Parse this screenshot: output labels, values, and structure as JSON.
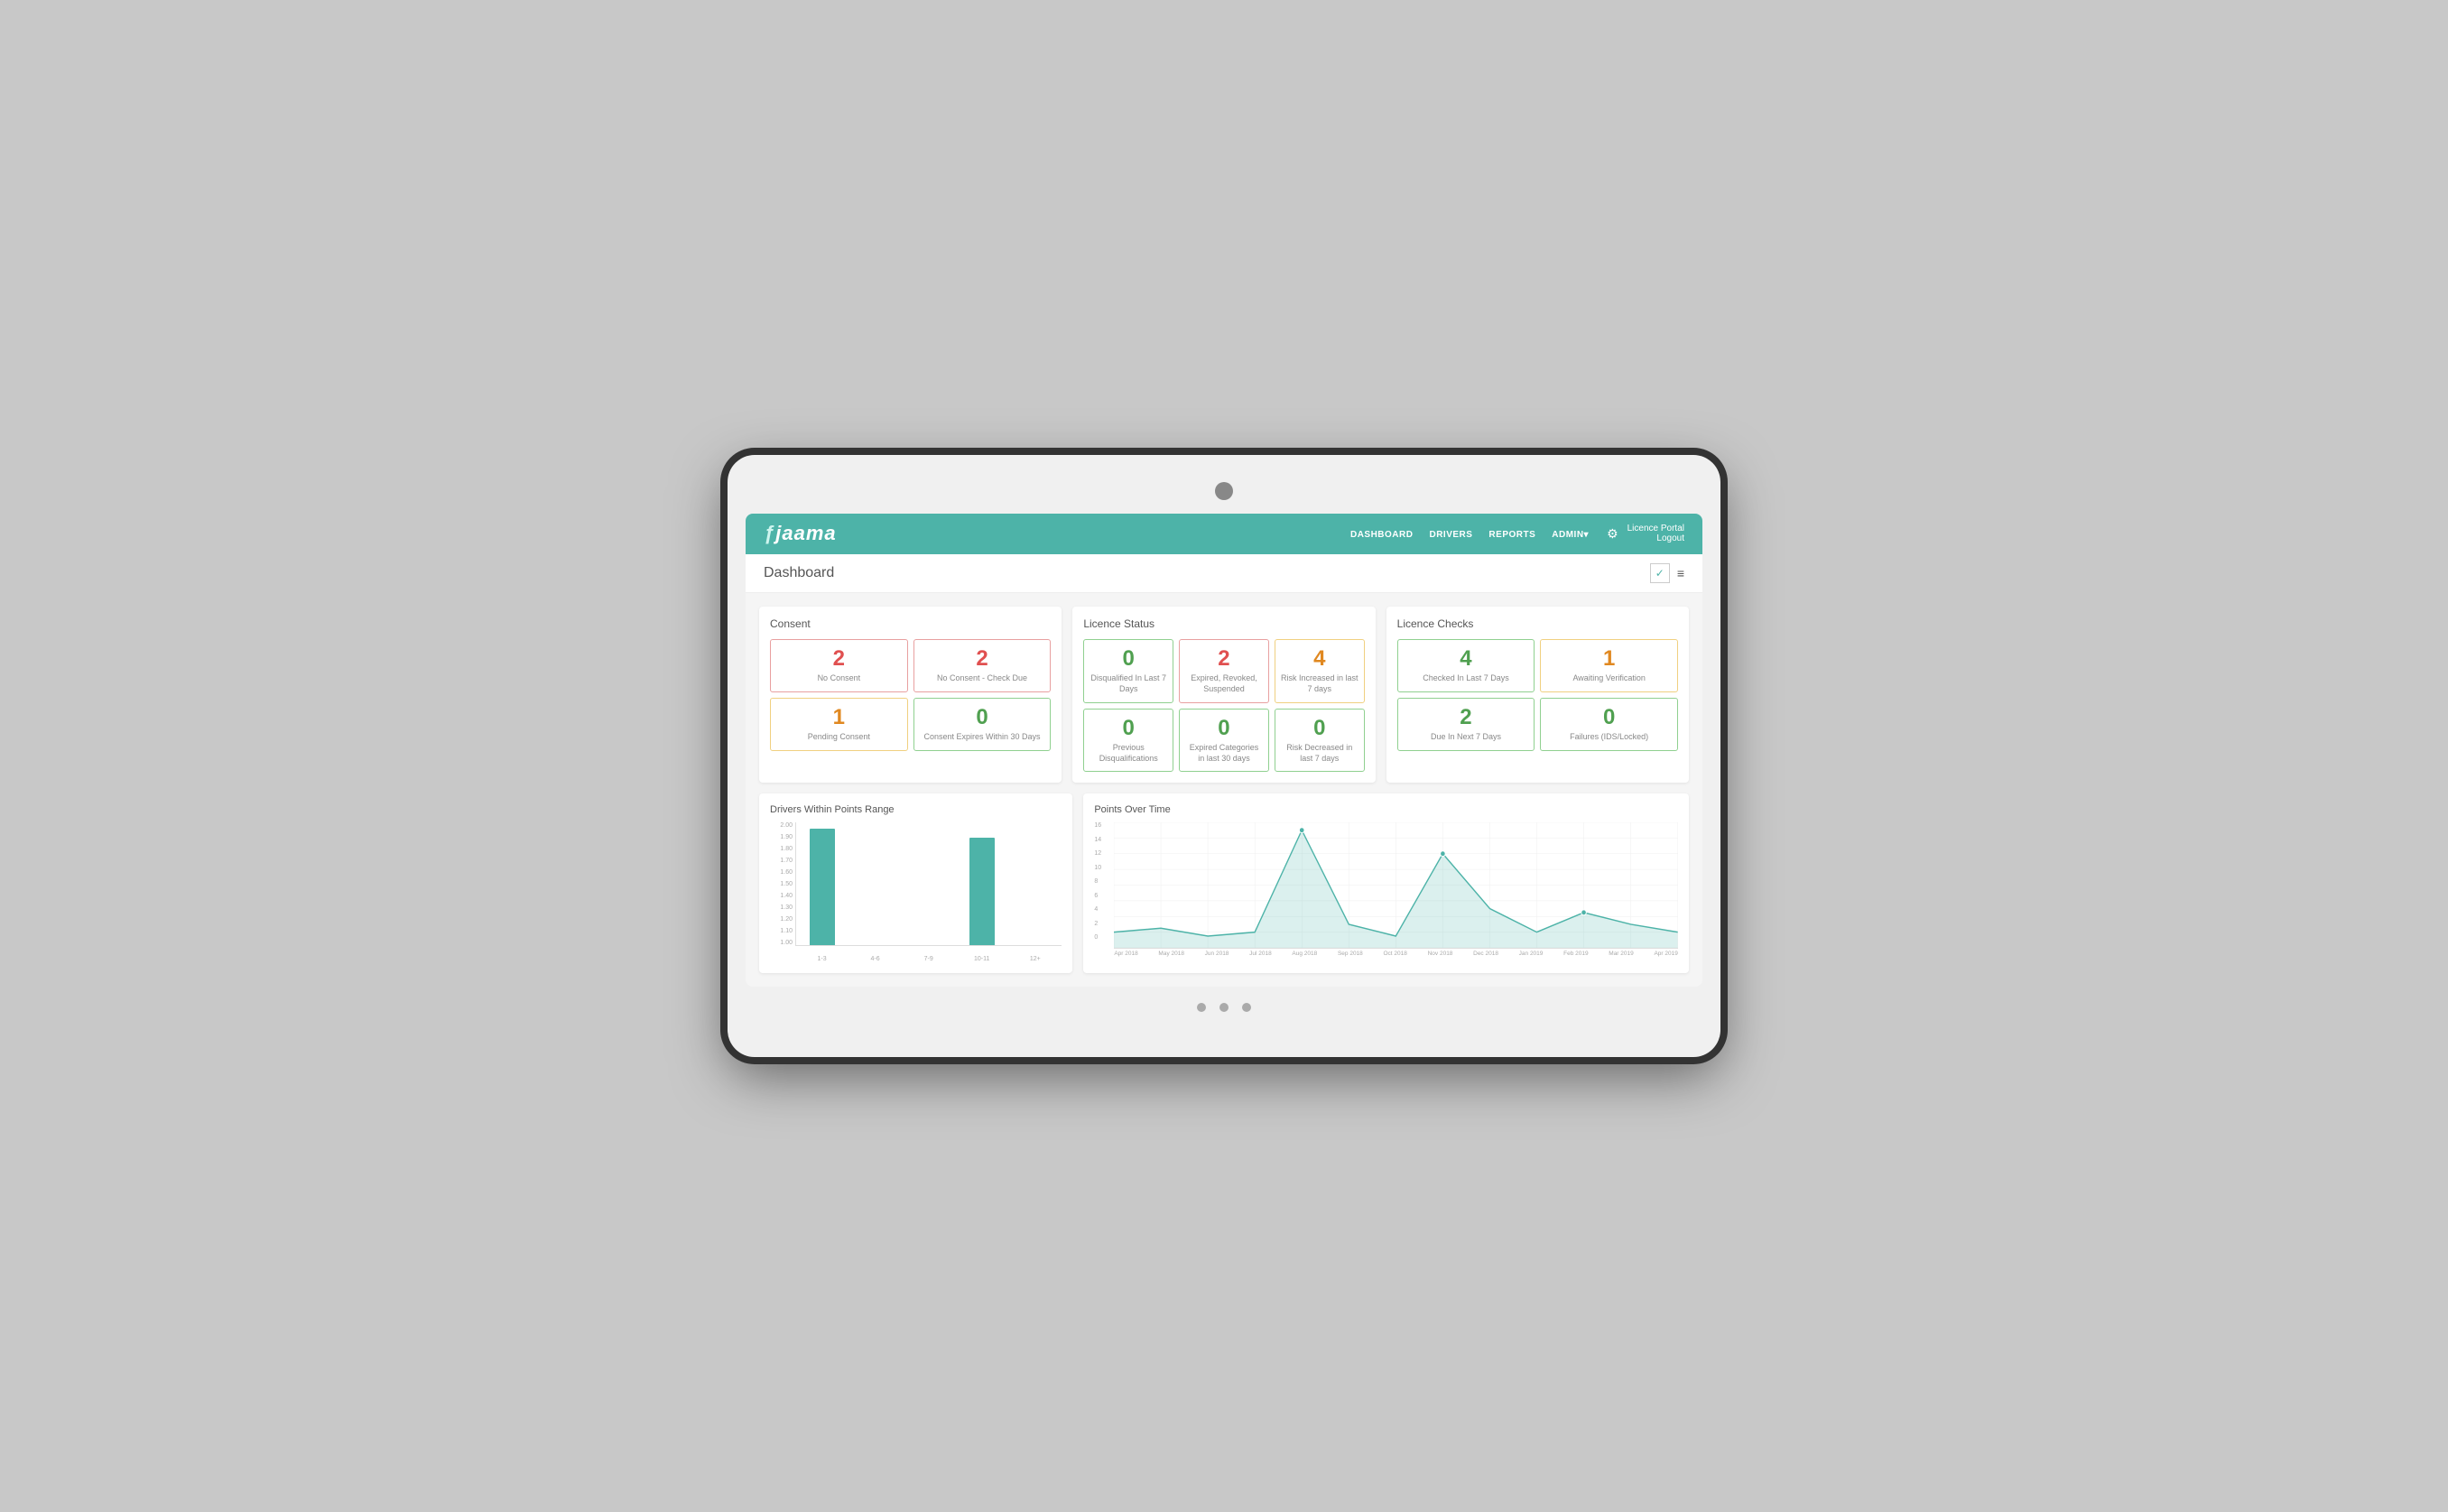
{
  "device": {
    "notch": true
  },
  "nav": {
    "logo": "jaama",
    "links": [
      "DASHBOARD",
      "DRIVERS",
      "REPORTS",
      "ADMIN▾"
    ],
    "licence_portal": "Licence Portal",
    "logout": "Logout"
  },
  "page": {
    "title": "Dashboard",
    "check_icon": "✓",
    "menu_icon": "≡"
  },
  "sections": {
    "consent": {
      "title": "Consent",
      "stats": [
        {
          "value": "2",
          "label": "No Consent",
          "color": "red",
          "border": "red-border"
        },
        {
          "value": "2",
          "label": "No Consent - Check Due",
          "color": "red",
          "border": "red-border"
        },
        {
          "value": "1",
          "label": "Pending Consent",
          "color": "orange",
          "border": "yellow-border"
        },
        {
          "value": "0",
          "label": "Consent Expires Within 30 Days",
          "color": "green",
          "border": "green-border"
        }
      ]
    },
    "licence_status": {
      "title": "Licence Status",
      "stats": [
        {
          "value": "0",
          "label": "Disqualified In Last 7 Days",
          "color": "green",
          "border": "green-border"
        },
        {
          "value": "2",
          "label": "Expired, Revoked, Suspended",
          "color": "red",
          "border": "red-border"
        },
        {
          "value": "4",
          "label": "Risk Increased in last 7 days",
          "color": "orange",
          "border": "yellow-border"
        },
        {
          "value": "0",
          "label": "Previous Disqualifications",
          "color": "green",
          "border": "green-border"
        },
        {
          "value": "0",
          "label": "Expired Categories in last 30 days",
          "color": "green",
          "border": "green-border"
        },
        {
          "value": "0",
          "label": "Risk Decreased in last 7 days",
          "color": "green",
          "border": "green-border"
        }
      ]
    },
    "licence_checks": {
      "title": "Licence Checks",
      "stats": [
        {
          "value": "4",
          "label": "Checked In Last 7 Days",
          "color": "green",
          "border": "green-border"
        },
        {
          "value": "1",
          "label": "Awaiting Verification",
          "color": "orange",
          "border": "yellow-border"
        },
        {
          "value": "2",
          "label": "Due In Next 7 Days",
          "color": "green",
          "border": "green-border"
        },
        {
          "value": "0",
          "label": "Failures (IDS/Locked)",
          "color": "green",
          "border": "green-border"
        }
      ]
    }
  },
  "bar_chart": {
    "title": "Drivers Within Points Range",
    "y_labels": [
      "2.00",
      "1.90",
      "1.80",
      "1.70",
      "1.60",
      "1.50",
      "1.40",
      "1.30",
      "1.20",
      "1.10",
      "1.00"
    ],
    "bars": [
      {
        "label": "1-3",
        "height_pct": 95
      },
      {
        "label": "4-6",
        "height_pct": 0
      },
      {
        "label": "7-9",
        "height_pct": 0
      },
      {
        "label": "10-11",
        "height_pct": 88
      },
      {
        "label": "12+",
        "height_pct": 0
      }
    ]
  },
  "line_chart": {
    "title": "Points Over Time",
    "y_max": 16,
    "y_labels": [
      "16",
      "14",
      "12",
      "10",
      "8",
      "6",
      "4",
      "2",
      "0"
    ],
    "x_labels": [
      "Apr 2018",
      "May 2018",
      "Jun 2018",
      "Jul 2018",
      "Aug 2018",
      "Sep 2018",
      "Oct 2018",
      "Nov 2018",
      "Dec 2018",
      "Jan 2019",
      "Feb 2019",
      "Mar 2019",
      "Apr 2019"
    ]
  }
}
